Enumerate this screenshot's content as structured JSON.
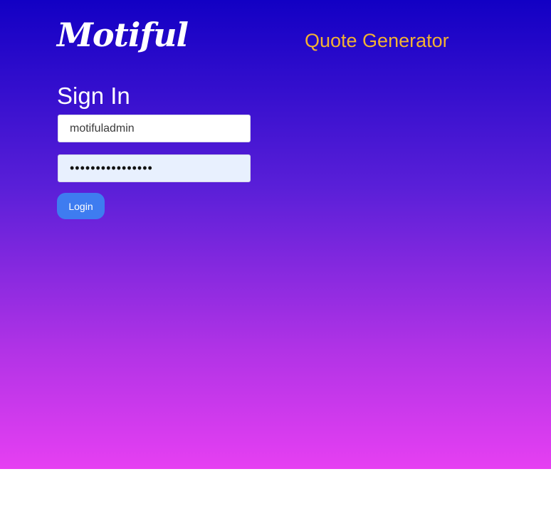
{
  "header": {
    "logo_text": "Motiful",
    "site_title": "Quote Generator"
  },
  "signin": {
    "heading": "Sign In",
    "username_value": "motifuladmin",
    "password_value": "••••••••••••••••",
    "login_label": "Login"
  },
  "colors": {
    "title_accent": "#f2b233",
    "button": "#3e7cf0",
    "gradient_top": "#1200c4",
    "gradient_bottom": "#e63ff2"
  }
}
